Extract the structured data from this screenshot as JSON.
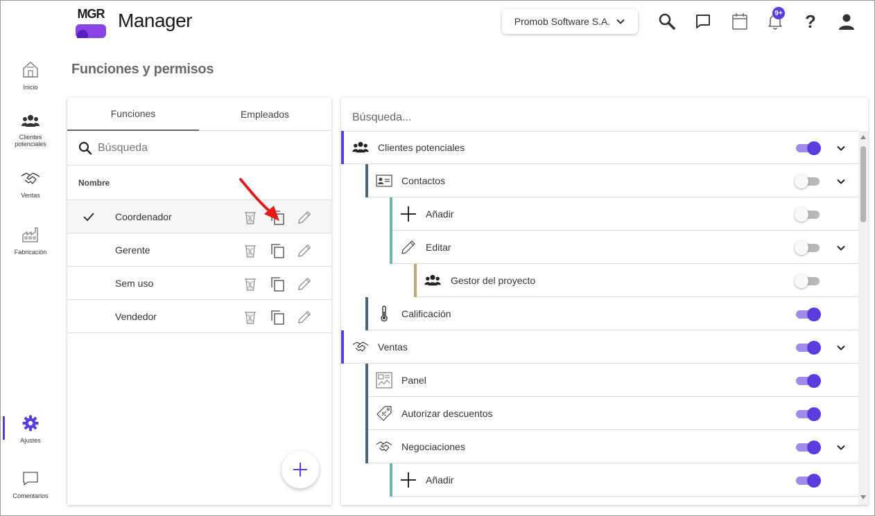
{
  "app": {
    "logo_text": "MGR",
    "title": "Manager",
    "company": "Promob Software S.A.",
    "notifications_badge": "9+"
  },
  "sidebar": {
    "items": [
      {
        "label": "Inicio",
        "icon": "house-icon"
      },
      {
        "label": "Clientes potenciales",
        "icon": "people-icon"
      },
      {
        "label": "Ventas",
        "icon": "handshake-icon"
      },
      {
        "label": "Fabricación",
        "icon": "factory-icon"
      },
      {
        "label": "Ajustes",
        "icon": "gear-icon",
        "active": true
      },
      {
        "label": "Comentarios",
        "icon": "chat-icon"
      }
    ]
  },
  "page": {
    "title": "Funciones y permisos"
  },
  "left_panel": {
    "tabs": [
      {
        "label": "Funciones",
        "active": true
      },
      {
        "label": "Empleados",
        "active": false
      }
    ],
    "search_placeholder": "Búsqueda",
    "column_header": "Nombre",
    "roles": [
      {
        "name": "Coordenador",
        "selected": true
      },
      {
        "name": "Gerente",
        "selected": false
      },
      {
        "name": "Sem uso",
        "selected": false
      },
      {
        "name": "Vendedor",
        "selected": false
      }
    ]
  },
  "right_panel": {
    "search_placeholder": "Búsqueda...",
    "permissions": [
      {
        "label": "Clientes potenciales",
        "level": 0,
        "icon": "people-icon",
        "on": true,
        "expandable": true
      },
      {
        "label": "Contactos",
        "level": 1,
        "icon": "contact-card-icon",
        "on": false,
        "expandable": true
      },
      {
        "label": "Añadir",
        "level": 2,
        "icon": "plus-icon",
        "on": false,
        "expandable": false
      },
      {
        "label": "Editar",
        "level": 2,
        "icon": "pencil-icon",
        "on": false,
        "expandable": true
      },
      {
        "label": "Gestor del proyecto",
        "level": 3,
        "icon": "people-icon",
        "on": false,
        "expandable": false
      },
      {
        "label": "Calificación",
        "level": 1,
        "icon": "thermometer-icon",
        "on": true,
        "expandable": false
      },
      {
        "label": "Ventas",
        "level": 0,
        "icon": "handshake-icon",
        "on": true,
        "expandable": true
      },
      {
        "label": "Panel",
        "level": 1,
        "icon": "dashboard-icon",
        "on": true,
        "expandable": false
      },
      {
        "label": "Autorizar descuentos",
        "level": 1,
        "icon": "discount-tag-icon",
        "on": true,
        "expandable": false
      },
      {
        "label": "Negociaciones",
        "level": 1,
        "icon": "handshake-icon",
        "on": true,
        "expandable": true
      },
      {
        "label": "Añadir",
        "level": 2,
        "icon": "plus-icon",
        "on": true,
        "expandable": false
      }
    ]
  },
  "colors": {
    "accent": "#5b3ce0",
    "level0_bar": "#5b3ce0",
    "level1_bar": "#4a6580",
    "level2_bar": "#6fb3b0",
    "level3_bar": "#c2a77e",
    "annotation_arrow": "#e31b1b"
  }
}
